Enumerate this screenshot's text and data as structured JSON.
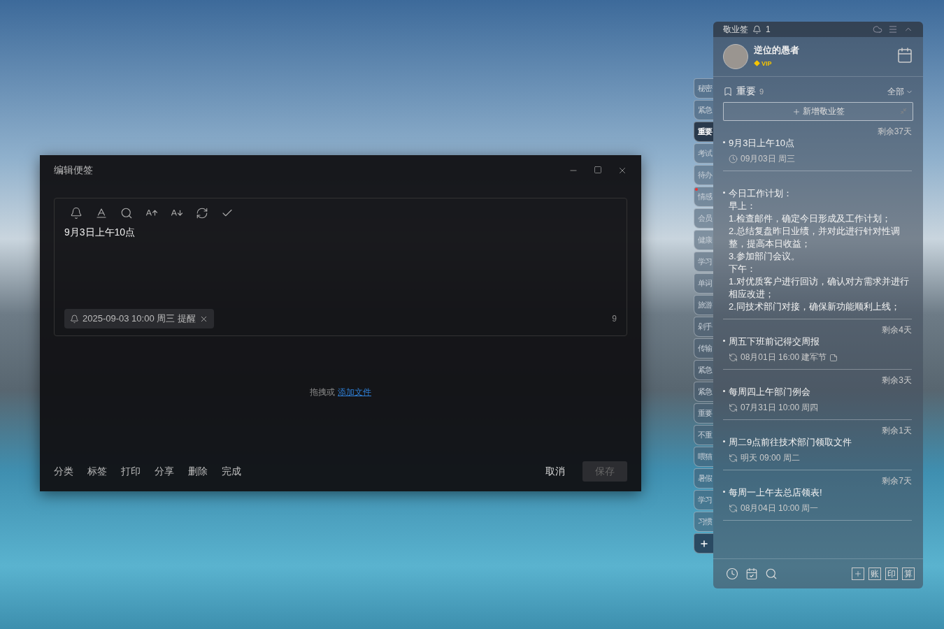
{
  "editor": {
    "title": "编辑便签",
    "content": "9月3日上午10点",
    "reminder": "2025-09-03 10:00 周三 提醒",
    "char_count": "9",
    "drop_hint": "拖拽或",
    "drop_link": "添加文件",
    "actions": [
      "分类",
      "标签",
      "打印",
      "分享",
      "删除",
      "完成"
    ],
    "cancel": "取消",
    "save": {
      "label": "保存",
      "disabled": true
    }
  },
  "side_tabs": [
    {
      "label": "秘密",
      "selected": false,
      "alert": false
    },
    {
      "label": "紧急",
      "selected": false,
      "alert": false
    },
    {
      "label": "重要",
      "selected": true,
      "alert": false
    },
    {
      "label": "考试",
      "selected": false,
      "alert": false
    },
    {
      "label": "待办",
      "selected": false,
      "alert": false
    },
    {
      "label": "情感",
      "selected": false,
      "alert": true
    },
    {
      "label": "会员",
      "selected": false,
      "alert": false
    },
    {
      "label": "健康",
      "selected": false,
      "alert": false
    },
    {
      "label": "学习",
      "selected": false,
      "alert": false
    },
    {
      "label": "单词",
      "selected": false,
      "alert": false
    },
    {
      "label": "旅游",
      "selected": false,
      "alert": false
    },
    {
      "label": "剁手",
      "selected": false,
      "alert": false
    },
    {
      "label": "传输",
      "selected": false,
      "alert": false
    },
    {
      "label": "紧急",
      "selected": false,
      "alert": false
    },
    {
      "label": "紧急",
      "selected": false,
      "alert": false
    },
    {
      "label": "重要",
      "selected": false,
      "alert": false
    },
    {
      "label": "不重",
      "selected": false,
      "alert": false
    },
    {
      "label": "喂猫",
      "selected": false,
      "alert": false
    },
    {
      "label": "暑假",
      "selected": false,
      "alert": false
    },
    {
      "label": "学习",
      "selected": false,
      "alert": false
    },
    {
      "label": "习惯",
      "selected": false,
      "alert": false
    }
  ],
  "panel": {
    "app_name": "敬业签",
    "notification_count": "1",
    "user": {
      "name": "逆位的愚者",
      "badge": "VIP"
    },
    "category": {
      "name": "重要",
      "count": "9"
    },
    "filter": "全部",
    "add_button": "新增敬业签",
    "notes": [
      {
        "remaining": "剩余37天",
        "lines": [
          "9月3日上午10点"
        ],
        "kind": "clock",
        "meta": "09月03日 周三",
        "attachment": false
      },
      {
        "lines": [
          "今日工作计划：",
          "早上：",
          "1.检查邮件，确定今日形成及工作计划；",
          "2.总结复盘昨日业绩，并对此进行针对性调整，提高本日收益；",
          "3.参加部门会议。",
          "下午：",
          "1.对优质客户进行回访，确认对方需求并进行相应改进；",
          "2.同技术部门对接，确保新功能顺利上线；"
        ]
      },
      {
        "remaining": "剩余4天",
        "lines": [
          "周五下班前记得交周报"
        ],
        "kind": "repeat",
        "meta": "08月01日 16:00 建军节",
        "attachment": true
      },
      {
        "remaining": "剩余3天",
        "lines": [
          "每周四上午部门例会"
        ],
        "kind": "repeat",
        "meta": "07月31日 10:00 周四",
        "attachment": false
      },
      {
        "remaining": "剩余1天",
        "lines": [
          "周二9点前往技术部门领取文件"
        ],
        "kind": "repeat",
        "meta": "明天 09:00 周二",
        "attachment": false
      },
      {
        "remaining": "剩余7天",
        "lines": [
          "每周一上午去总店领表!"
        ],
        "kind": "repeat",
        "meta": "08月04日 10:00 周一",
        "attachment": false
      }
    ],
    "bottom_tools": [
      "账",
      "印",
      "算"
    ]
  }
}
